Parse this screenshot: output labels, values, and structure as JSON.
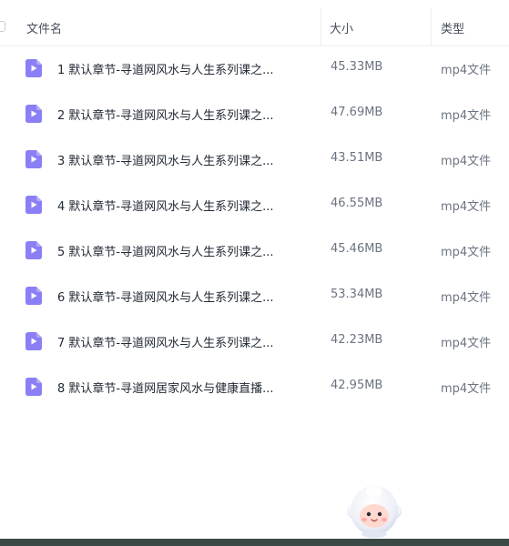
{
  "table": {
    "headers": {
      "name": "文件名",
      "size": "大小",
      "type": "类型"
    },
    "rows": [
      {
        "name": "1 默认章节-寻道网风水与人生系列课之...",
        "size": "45.33MB",
        "type": "mp4文件",
        "icon": "video-file-icon"
      },
      {
        "name": "2 默认章节-寻道网风水与人生系列课之...",
        "size": "47.69MB",
        "type": "mp4文件",
        "icon": "video-file-icon"
      },
      {
        "name": "3 默认章节-寻道网风水与人生系列课之...",
        "size": "43.51MB",
        "type": "mp4文件",
        "icon": "video-file-icon"
      },
      {
        "name": "4 默认章节-寻道网风水与人生系列课之...",
        "size": "46.55MB",
        "type": "mp4文件",
        "icon": "video-file-icon"
      },
      {
        "name": "5 默认章节-寻道网风水与人生系列课之...",
        "size": "45.46MB",
        "type": "mp4文件",
        "icon": "video-file-icon"
      },
      {
        "name": "6 默认章节-寻道网风水与人生系列课之...",
        "size": "53.34MB",
        "type": "mp4文件",
        "icon": "video-file-icon"
      },
      {
        "name": "7 默认章节-寻道网风水与人生系列课之...",
        "size": "42.23MB",
        "type": "mp4文件",
        "icon": "video-file-icon"
      },
      {
        "name": "8 默认章节-寻道网居家风水与健康直播...",
        "size": "42.95MB",
        "type": "mp4文件",
        "icon": "video-file-icon"
      }
    ]
  },
  "colors": {
    "file_icon": "#8b7ff5",
    "header_text": "#454d5a",
    "name_text": "#222a35",
    "meta_text": "#6b7380"
  }
}
